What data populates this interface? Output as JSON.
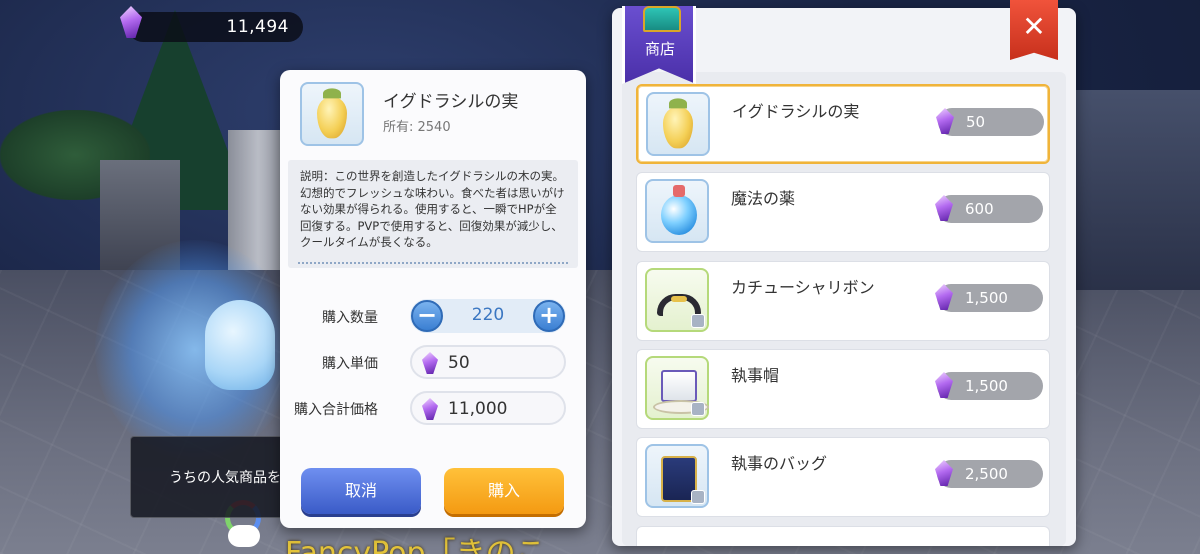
{
  "currency": {
    "amount": "11,494",
    "icon": "purple-crystal-icon"
  },
  "tooltip": {
    "text": "うちの人気商品を"
  },
  "scene": {
    "bottom_text": "FancyPop「きのこ"
  },
  "dialog": {
    "item_name": "イグドラシルの実",
    "owned": "所有: 2540",
    "description": "説明：この世界を創造したイグドラシルの木の実。幻想的でフレッシュな味わい。食べた者は思いがけない効果が得られる。使用すると、一瞬でHPが全回復する。PVPで使用すると、回復効果が減少し、クールタイムが長くなる。",
    "quantity_label": "購入数量",
    "quantity_value": "220",
    "minus_label": "−",
    "plus_label": "+",
    "unit_price_label": "購入単価",
    "unit_price_value": "50",
    "total_label": "購入合計価格",
    "total_value": "11,000",
    "cancel_label": "取消",
    "buy_label": "購入"
  },
  "shop": {
    "title": "商店",
    "close_label": "✕",
    "items": [
      {
        "name": "イグドラシルの実",
        "price": "50",
        "icon": "fruit-icon",
        "selected": true
      },
      {
        "name": "魔法の薬",
        "price": "600",
        "icon": "potion-icon",
        "selected": false
      },
      {
        "name": "カチューシャリボン",
        "price": "1,500",
        "icon": "ribbon-headband-icon",
        "selected": false
      },
      {
        "name": "執事帽",
        "price": "1,500",
        "icon": "top-hat-icon",
        "selected": false
      },
      {
        "name": "執事のバッグ",
        "price": "2,500",
        "icon": "bag-icon",
        "selected": false
      }
    ]
  },
  "colors": {
    "accent_orange": "#f49a12",
    "accent_blue": "#3a5bc7",
    "close_red": "#d93a22",
    "banner_purple": "#5a3cc0"
  }
}
